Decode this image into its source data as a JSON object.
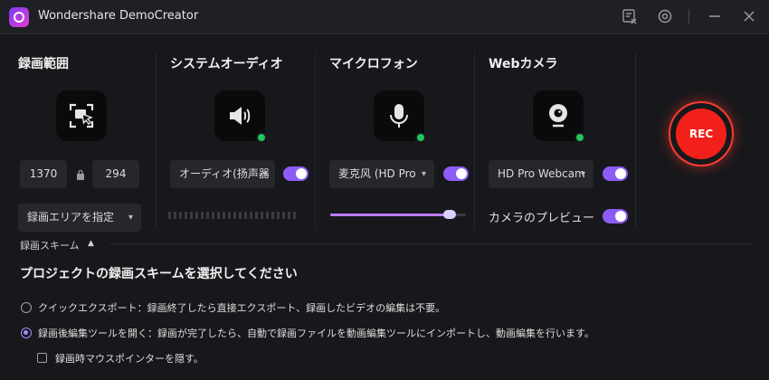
{
  "app": {
    "title": "Wondershare DemoCreator"
  },
  "panels": {
    "region": {
      "title": "録画範囲",
      "width": "1370",
      "height": "294",
      "mode": "録画エリアを指定",
      "icon": "screen-select-icon"
    },
    "system_audio": {
      "title": "システムオーディオ",
      "device": "オーディオ(扬声器",
      "icon": "speaker-icon",
      "enabled": true
    },
    "microphone": {
      "title": "マイクロフォン",
      "device": "麦克风 (HD Pro",
      "icon": "microphone-icon",
      "enabled": true,
      "volume_fraction": 0.88
    },
    "webcam": {
      "title": "Webカメラ",
      "device": "HD Pro Webcam",
      "preview_label": "カメラのプレビュー",
      "icon": "webcam-icon",
      "enabled": true,
      "preview_enabled": true
    }
  },
  "rec_button": {
    "label": "REC"
  },
  "scheme": {
    "section_label": "録画スキーム",
    "heading": "プロジェクトの録画スキームを選択してください",
    "options": [
      {
        "label": "クイックエクスポート：録画終了したら直接エクスポート、録画したビデオの編集は不要。",
        "selected": false
      },
      {
        "label": "録画後編集ツールを開く：録画が完了したら、自動で録画ファイルを動画編集ツールにインポートし、動画編集を行います。",
        "selected": true
      }
    ],
    "hide_pointer_label": "録画時マウスポインターを隠す。"
  },
  "colors": {
    "accent": "#8b5cf6",
    "rec": "#f2201a",
    "ok": "#22c55e"
  }
}
